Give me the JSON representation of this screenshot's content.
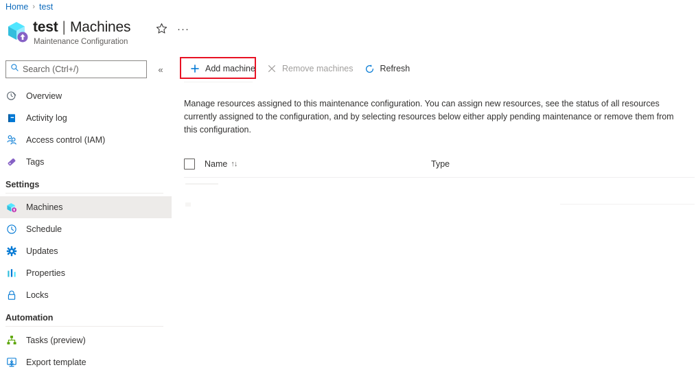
{
  "breadcrumb": {
    "items": [
      {
        "label": "Home",
        "name": "breadcrumb-home"
      },
      {
        "label": "test",
        "name": "breadcrumb-test"
      }
    ],
    "separator": "›"
  },
  "header": {
    "title_resource": "test",
    "title_separator": "|",
    "title_page": "Machines",
    "subtitle": "Maintenance Configuration",
    "resource_icon": "maintenance-configuration-cube-icon",
    "favorite_icon": "star-outline-icon",
    "more_icon": "ellipsis-icon",
    "more_label": "···"
  },
  "sidebar": {
    "search": {
      "placeholder": "Search (Ctrl+/)",
      "value": "",
      "icon": "search-icon"
    },
    "collapse": {
      "icon": "chevron-double-left-icon",
      "glyph": "«"
    },
    "items": [
      {
        "label": "Overview",
        "icon": "overview-clock-icon",
        "name": "sidebar-item-overview",
        "selected": false
      },
      {
        "label": "Activity log",
        "icon": "activity-log-book-icon",
        "name": "sidebar-item-activity-log",
        "selected": false
      },
      {
        "label": "Access control (IAM)",
        "icon": "access-control-people-icon",
        "name": "sidebar-item-access-control",
        "selected": false
      },
      {
        "label": "Tags",
        "icon": "tags-icon",
        "name": "sidebar-item-tags",
        "selected": false
      }
    ],
    "groups": [
      {
        "label": "Settings",
        "name": "sidebar-group-settings",
        "items": [
          {
            "label": "Machines",
            "icon": "machines-cube-icon",
            "name": "sidebar-item-machines",
            "selected": true
          },
          {
            "label": "Schedule",
            "icon": "schedule-clock-icon",
            "name": "sidebar-item-schedule",
            "selected": false
          },
          {
            "label": "Updates",
            "icon": "updates-gear-icon",
            "name": "sidebar-item-updates",
            "selected": false
          },
          {
            "label": "Properties",
            "icon": "properties-bars-icon",
            "name": "sidebar-item-properties",
            "selected": false
          },
          {
            "label": "Locks",
            "icon": "locks-padlock-icon",
            "name": "sidebar-item-locks",
            "selected": false
          }
        ]
      },
      {
        "label": "Automation",
        "name": "sidebar-group-automation",
        "items": [
          {
            "label": "Tasks (preview)",
            "icon": "tasks-hierarchy-icon",
            "name": "sidebar-item-tasks",
            "selected": false
          },
          {
            "label": "Export template",
            "icon": "export-template-icon",
            "name": "sidebar-item-export-template",
            "selected": false
          }
        ]
      }
    ]
  },
  "toolbar": {
    "add_machine_label": "Add machine",
    "add_machine_icon": "plus-icon",
    "remove_machines_label": "Remove machines",
    "remove_machines_icon": "close-x-icon",
    "remove_machines_disabled": true,
    "refresh_label": "Refresh",
    "refresh_icon": "refresh-circular-arrow-icon"
  },
  "highlight": {
    "target": "add-machine-button",
    "color": "#e81123"
  },
  "main": {
    "description": "Manage resources assigned to this maintenance configuration. You can assign new resources, see the status of all resources currently assigned to the configuration, and by selecting resources below either apply pending maintenance or remove them from this configuration.",
    "table": {
      "select_all_checkbox": "select-all-checkbox",
      "columns": [
        {
          "label": "Name",
          "name": "column-header-name",
          "sortable": true,
          "sort_glyph": "↑↓"
        },
        {
          "label": "Type",
          "name": "column-header-type",
          "sortable": false,
          "sort_glyph": ""
        }
      ],
      "rows": []
    }
  },
  "colors": {
    "accent": "#0078d4",
    "link": "#0f6cbd",
    "highlight": "#e81123",
    "selected_bg": "#edebe9",
    "text": "#201f1e",
    "muted": "#605e5c",
    "disabled": "#a19f9d"
  }
}
